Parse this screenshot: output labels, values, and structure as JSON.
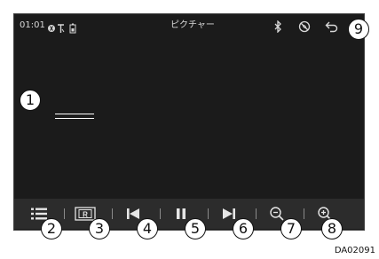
{
  "status_bar": {
    "time": "01:01",
    "title": "ピクチャー",
    "icons": [
      "bluetooth-phone-icon",
      "signal-icon",
      "battery-icon",
      "bluetooth-icon",
      "no-signal-icon",
      "back-icon"
    ]
  },
  "toolbar": {
    "buttons": [
      "menu-list",
      "repeat",
      "previous",
      "pause",
      "next",
      "zoom-out",
      "zoom-in"
    ]
  },
  "callouts": {
    "c1": "1",
    "c2": "2",
    "c3": "3",
    "c4": "4",
    "c5": "5",
    "c6": "6",
    "c7": "7",
    "c8": "8",
    "c9": "9"
  },
  "figure_code": "DA02091",
  "colors": {
    "screen_bg": "#1b1b1b",
    "toolbar_bg": "#2c2c2c",
    "icon": "#e6e6e6"
  }
}
